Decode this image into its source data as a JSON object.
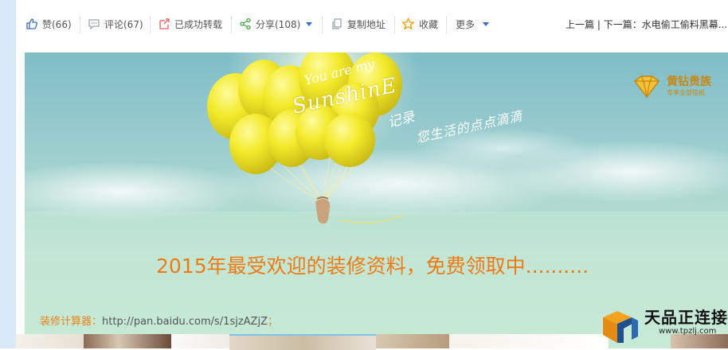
{
  "toolbar": {
    "like_label": "赞(66)",
    "comment_label": "评论(67)",
    "repost_label": "已成功转载",
    "share_label": "分享(108)",
    "copy_label": "复制地址",
    "favorite_label": "收藏",
    "more_label": "更多"
  },
  "nav": {
    "prev": "上一篇",
    "separator": " | ",
    "next": "下一篇：水电偷工偷料黑幕..."
  },
  "banner": {
    "balloon_script_top": "You are my",
    "balloon_script_main": "SunshinE",
    "handwriting_line1": "记录",
    "handwriting_line2": "您生活的点点滴滴",
    "vip_title": "黄钻贵族",
    "vip_subtitle": "专享全部信纸",
    "headline": "2015年最受欢迎的装修资料，免费领取中..........",
    "calc_label": "装修计算器：",
    "calc_url": "http://pan.baidu.com/s/1sjzAZjZ",
    "calc_semicolon": "；"
  },
  "watermark": {
    "title": "天品正连接",
    "url": "www.tpzlj.com"
  },
  "colors": {
    "accent": "#3a6fb8",
    "headline": "#f07a12",
    "vip_gold": "#c9860c",
    "balloon": "#f2ea2a"
  }
}
